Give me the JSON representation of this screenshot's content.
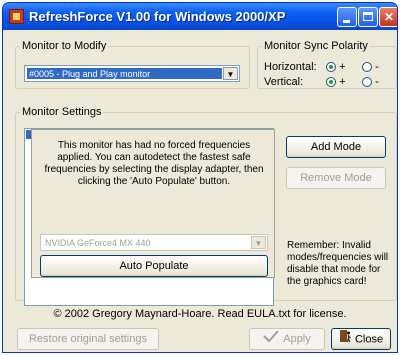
{
  "window": {
    "title": "RefreshForce V1.00 for Windows 2000/XP"
  },
  "monitor_group": {
    "legend": "Monitor to Modify",
    "selected": "#0005 - Plug and Play monitor"
  },
  "sync_group": {
    "legend": "Monitor Sync Polarity",
    "horizontal_label": "Horizontal:",
    "vertical_label": "Vertical:",
    "plus": "+",
    "minus": "-",
    "horizontal_value": "+",
    "vertical_value": "+"
  },
  "settings_group": {
    "legend": "Monitor Settings",
    "notice": "This monitor has had no forced frequencies applied.  You can autodetect the fastest safe frequencies by selecting the display adapter, then clicking the 'Auto Populate' button.",
    "adapter_selected": "NVIDIA GeForce4 MX 440",
    "auto_populate_label": "Auto Populate",
    "add_mode_label": "Add Mode",
    "remove_mode_label": "Remove Mode",
    "remember_text": "Remember: Invalid modes/frequencies will disable that mode for the graphics card!"
  },
  "footer": {
    "copyright": "© 2002 Gregory Maynard-Hoare.  Read EULA.txt for license.",
    "restore_label": "Restore original settings",
    "apply_label": "Apply",
    "close_label": "Close"
  },
  "icons": {
    "app": "refreshforce-app-icon",
    "apply": "checkmark-icon",
    "close": "door-exit-icon"
  }
}
